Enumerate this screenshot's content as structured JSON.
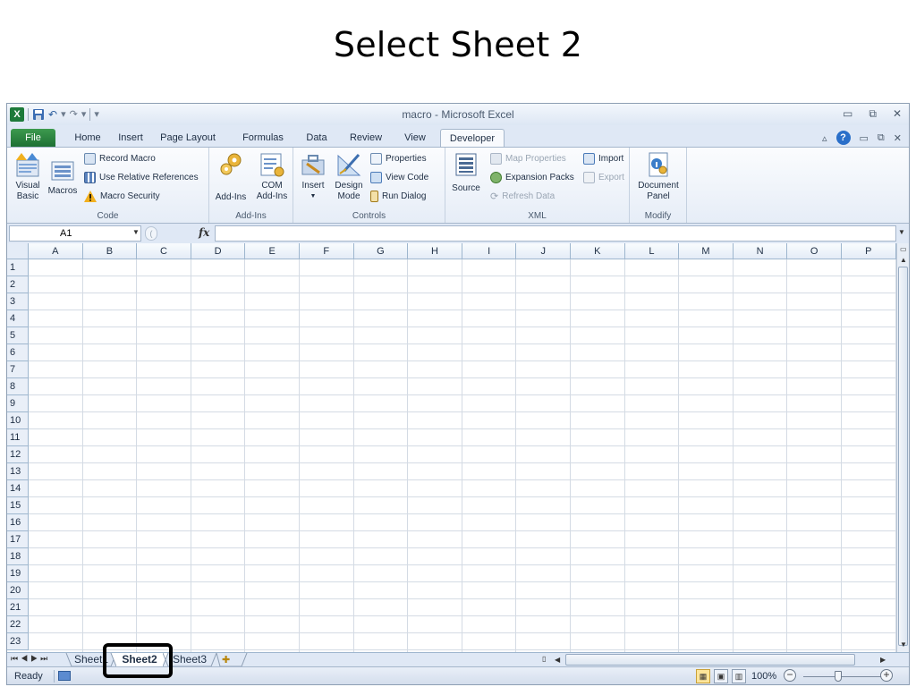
{
  "slide": {
    "title": "Select Sheet 2"
  },
  "window": {
    "title": "macro  -  Microsoft Excel",
    "app_icon": "X",
    "controls": [
      "▭",
      "⧉",
      "✕"
    ]
  },
  "qat": {
    "save_icon": "save-icon",
    "undo_icon": "↶",
    "redo_icon": "↷",
    "dropdown": "▾"
  },
  "tabs": [
    {
      "label": "File"
    },
    {
      "label": "Home"
    },
    {
      "label": "Insert"
    },
    {
      "label": "Page Layout"
    },
    {
      "label": "Formulas"
    },
    {
      "label": "Data"
    },
    {
      "label": "Review"
    },
    {
      "label": "View"
    },
    {
      "label": "Developer"
    }
  ],
  "ribbon": {
    "code": {
      "label": "Code",
      "visual_basic": "Visual\nBasic",
      "macros": "Macros",
      "record_macro": "Record Macro",
      "use_relative": "Use Relative References",
      "macro_security": "Macro Security"
    },
    "addins": {
      "label": "Add-Ins",
      "addins": "Add-Ins",
      "com_addins": "COM\nAdd-Ins"
    },
    "controls": {
      "label": "Controls",
      "insert": "Insert",
      "design_mode": "Design\nMode",
      "properties": "Properties",
      "view_code": "View Code",
      "run_dialog": "Run Dialog"
    },
    "xml": {
      "label": "XML",
      "source": "Source",
      "map_properties": "Map Properties",
      "expansion_packs": "Expansion Packs",
      "refresh_data": "Refresh Data",
      "import": "Import",
      "export": "Export"
    },
    "modify": {
      "label": "Modify",
      "document_panel": "Document\nPanel"
    }
  },
  "formula_bar": {
    "name_box": "A1",
    "fx": "fx",
    "value": ""
  },
  "grid": {
    "columns": [
      "A",
      "B",
      "C",
      "D",
      "E",
      "F",
      "G",
      "H",
      "I",
      "J",
      "K",
      "L",
      "M",
      "N",
      "O",
      "P"
    ],
    "rows": [
      "1",
      "2",
      "3",
      "4",
      "5",
      "6",
      "7",
      "8",
      "9",
      "10",
      "11",
      "12",
      "13",
      "14",
      "15",
      "16",
      "17",
      "18",
      "19",
      "20",
      "21",
      "22",
      "23"
    ]
  },
  "sheets": [
    {
      "label": "Sheet1",
      "active": false
    },
    {
      "label": "Sheet2",
      "active": true
    },
    {
      "label": "Sheet3",
      "active": false
    }
  ],
  "status": {
    "ready": "Ready",
    "zoom": "100%"
  },
  "colors": {
    "excel_green": "#1d7a3a",
    "ribbon_bg": "#e6edf7",
    "highlight": "#000000"
  }
}
